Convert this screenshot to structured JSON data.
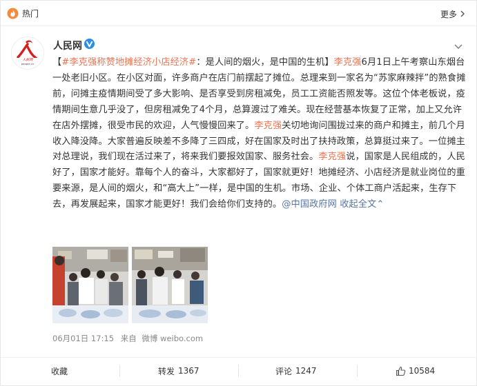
{
  "header": {
    "title": "热门",
    "more_label": "更多"
  },
  "post": {
    "user": "人民网",
    "avatar_text": "人民网",
    "avatar_subtext": "people.cn",
    "text_segments": [
      {
        "text": "【",
        "style": "normal"
      },
      {
        "text": "#李克强称赞地摊经济小店经济#",
        "style": "link"
      },
      {
        "text": "：是人间的烟火，是中国的生机】",
        "style": "normal"
      },
      {
        "text": "李克强",
        "style": "link"
      },
      {
        "text": "6月1日上午考察山东烟台一处老旧小区。在小区对面，许多商户在店门前摆起了摊位。总理来到一家名为“苏家麻辣拌”的熟食摊前，问摊主疫情期间受了多大影响、是否享受到房租减免，员工工资能否照发等。这位个体老板说，疫情期间生意几乎没了，但房租减免了4个月，总算渡过了难关。现在经营基本恢复了正常，加上又允许在店外摆摊，很受市民的欢迎，人气慢慢回来了。",
        "style": "normal"
      },
      {
        "text": "李克强",
        "style": "link"
      },
      {
        "text": "关切地询问围拢过来的商户和摊主，前几个月收入降没降。大家普遍反映差不多降了三四成，好在国家及时出了扶持政策，总算挺过来了。一位摊主对总理说，我们现在活过来了，将来我们要报效国家、服务社会。",
        "style": "normal"
      },
      {
        "text": "李克强",
        "style": "link"
      },
      {
        "text": "说，国家是人民组成的，人民好了，国家才能好。靠每个人的奋斗，大家都好了，国家就更好！地摊经济、小店经济是就业岗位的重要来源，是人间的烟火，和“高大上”一样，是中国的生机。市场、企业、个体工商户活起来，生存下去，再发展起来，国家才能更好！我们会给你们支持的。",
        "style": "normal"
      },
      {
        "text": "@中国政府网",
        "style": "blue"
      },
      {
        "text": " 收起全文",
        "style": "blue"
      },
      {
        "text": "⌃",
        "style": "blue"
      }
    ],
    "timestamp": "06月01日 17:15",
    "source_prefix": "来自",
    "source": "微博 weibo.com"
  },
  "actions": {
    "favorite_label": "收藏",
    "repost_label": "转发",
    "repost_count": "1367",
    "comment_label": "评论",
    "comment_count": "1247",
    "like_count": "10584"
  },
  "colors": {
    "accent_orange": "#eb7350",
    "link_blue": "#5574a3",
    "verified_blue": "#2b8fe6",
    "hot_orange": "#f28c3c"
  }
}
